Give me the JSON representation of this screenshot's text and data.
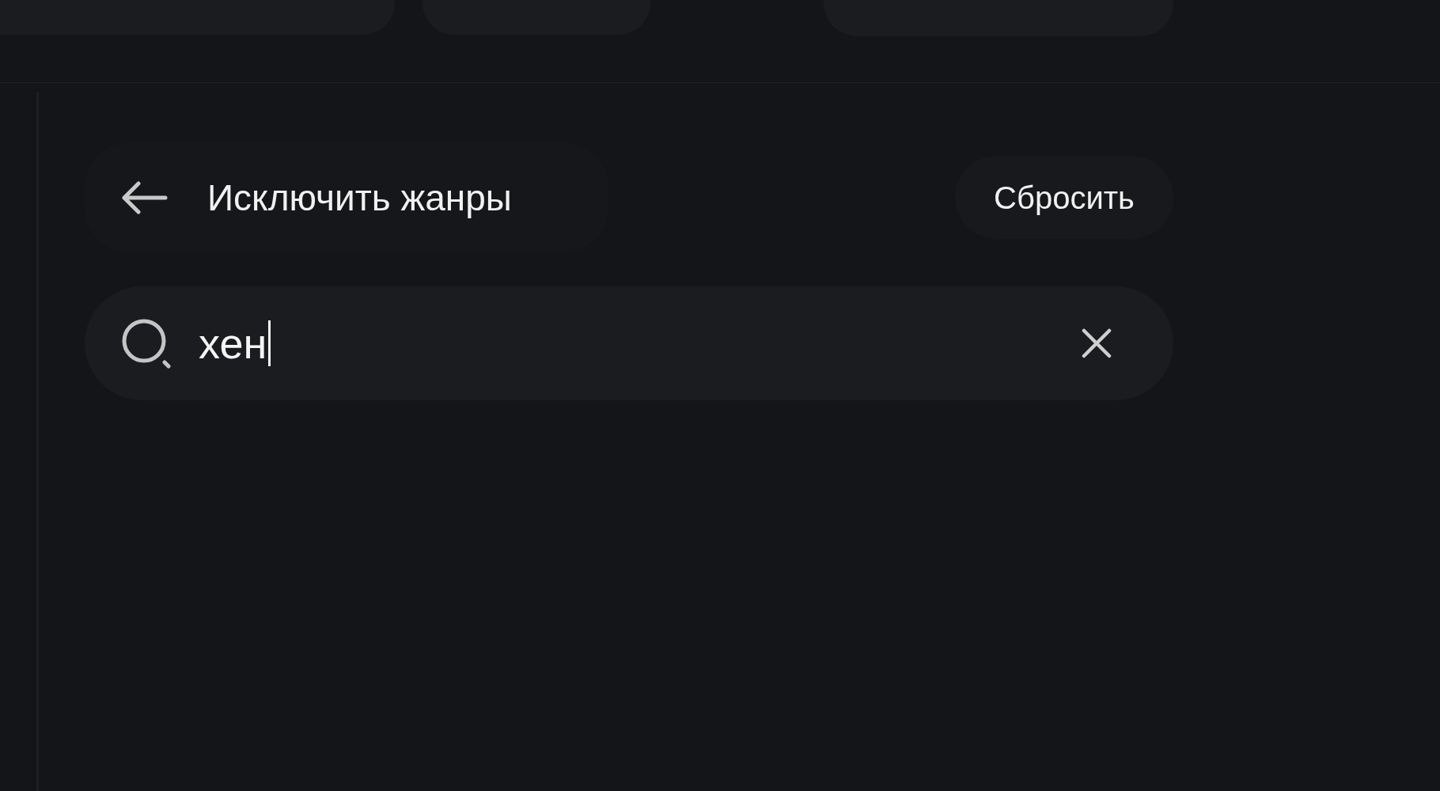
{
  "top_chips": [
    {
      "kind": "pill"
    },
    {
      "kind": "pill"
    },
    {
      "kind": "pill"
    }
  ],
  "panel": {
    "title": "Исключить жанры",
    "reset_button": "Сбросить",
    "search": {
      "value": "хен",
      "focused": true
    }
  }
}
